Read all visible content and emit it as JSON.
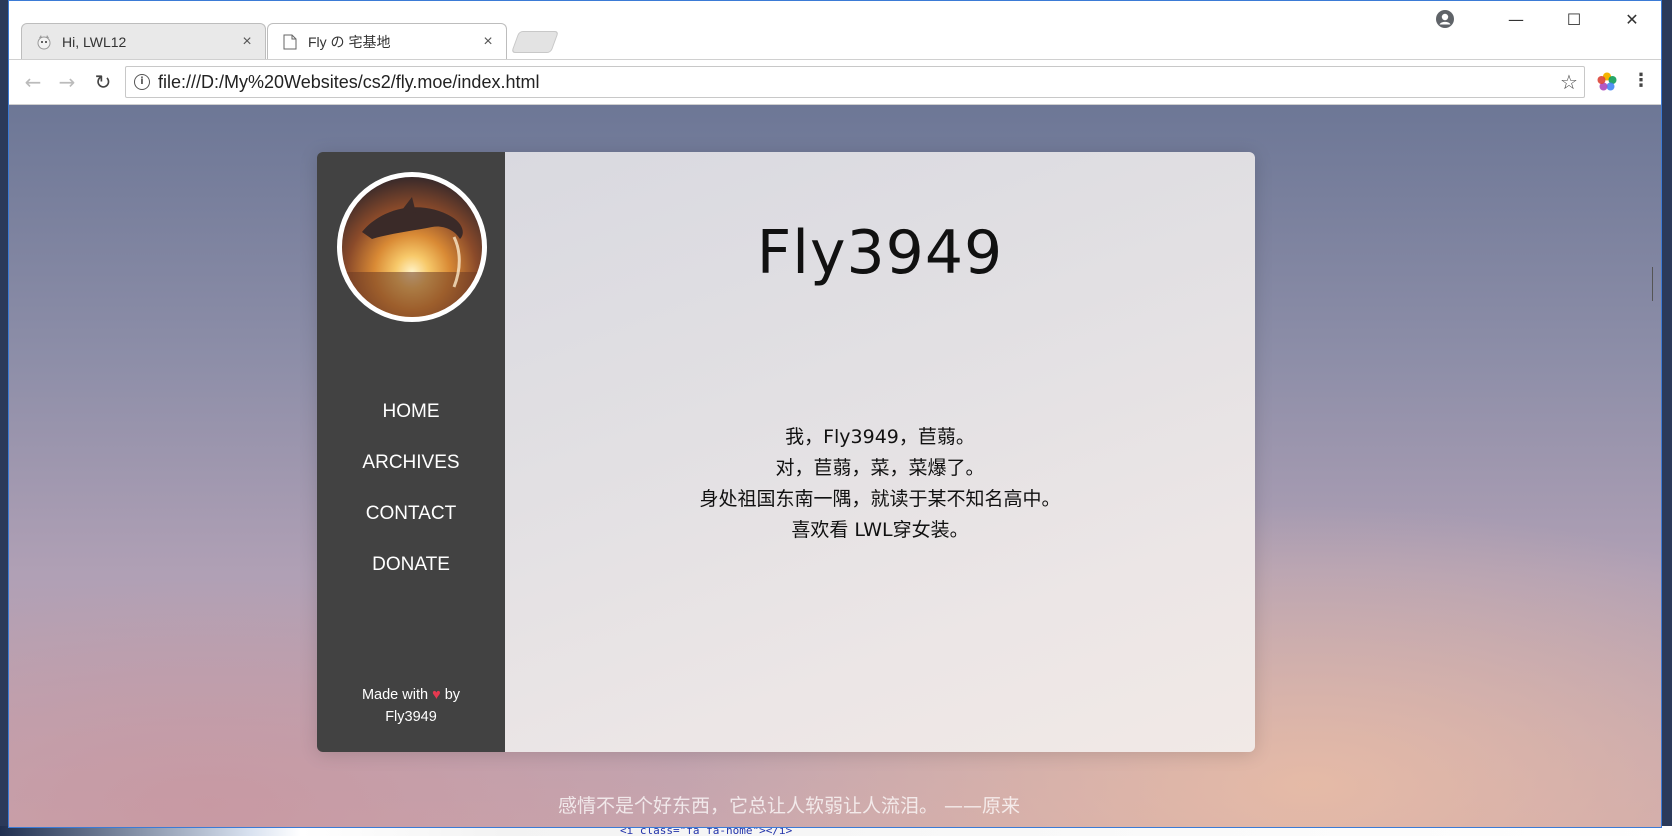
{
  "browser": {
    "tabs": [
      {
        "title": "Hi, LWL12",
        "close_label": "×"
      },
      {
        "title": "Fly の 宅基地",
        "close_label": "×"
      }
    ],
    "url": "file:///D:/My%20Websites/cs2/fly.moe/index.html",
    "window_controls": {
      "minimize": "—",
      "maximize": "☐",
      "close": "✕"
    },
    "nav": {
      "back": "←",
      "forward": "→",
      "reload": "↻",
      "info": "i",
      "star": "☆",
      "menu": "⋮"
    }
  },
  "site": {
    "nav": [
      "HOME",
      "ARCHIVES",
      "CONTACT",
      "DONATE"
    ],
    "credit_prefix": "Made with",
    "credit_heart": "♥",
    "credit_by": "by",
    "credit_author": "Fly3949",
    "title": "Fly3949",
    "intro": [
      "我，Fly3949，苣蒻。",
      "对，苣蒻，菜，菜爆了。",
      "身处祖国东南一隅，就读于某不知名高中。",
      "喜欢看 LWL穿女装。"
    ],
    "quote": "感情不是个好东西，它总让人软弱让人流泪。 ——原来"
  },
  "desktop": {
    "code_snippet": "<i class=\"fa fa-home\"></i>"
  },
  "colors": {
    "sidebar": "#424242",
    "heart": "#e63950"
  }
}
